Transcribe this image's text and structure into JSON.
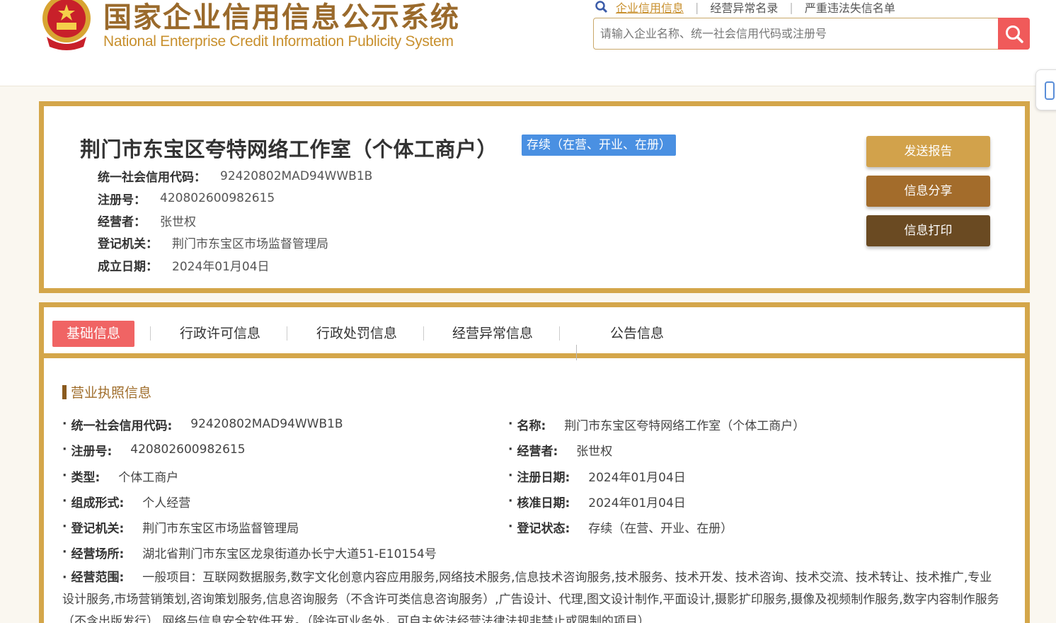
{
  "header": {
    "title": "国家企业信用信息公示系统",
    "subtitle": "National Enterprise Credit Information Publicity System",
    "links": [
      "企业信用信息",
      "经营异常名录",
      "严重违法失信名单"
    ],
    "search_placeholder": "请输入企业名称、统一社会信用代码或注册号"
  },
  "company": {
    "name": "荆门市东宝区夸特网络工作室（个体工商户）",
    "status": "存续（在营、开业、在册）",
    "rows": [
      {
        "label": "统一社会信用代码：",
        "value": "92420802MAD94WWB1B"
      },
      {
        "label": "注册号：",
        "value": "420802600982615"
      },
      {
        "label": "经营者：",
        "value": "张世权"
      },
      {
        "label": "登记机关：",
        "value": "荆门市东宝区市场监督管理局"
      },
      {
        "label": "成立日期：",
        "value": "2024年01月04日"
      }
    ],
    "buttons": {
      "report": "发送报告",
      "share": "信息分享",
      "print": "信息打印"
    }
  },
  "tabs": [
    "基础信息",
    "行政许可信息",
    "行政处罚信息",
    "经营异常信息",
    "公告信息"
  ],
  "section": {
    "title": "营业执照信息",
    "left": [
      {
        "label": "统一社会信用代码:",
        "value": "92420802MAD94WWB1B"
      },
      {
        "label": "注册号:",
        "value": "420802600982615"
      },
      {
        "label": "类型:",
        "value": "个体工商户"
      },
      {
        "label": "组成形式:",
        "value": "个人经营"
      },
      {
        "label": "登记机关:",
        "value": "荆门市东宝区市场监督管理局"
      },
      {
        "label": "经营场所:",
        "value": "湖北省荆门市东宝区龙泉街道办长宁大道51-E10154号"
      }
    ],
    "right": [
      {
        "label": "名称:",
        "value": "荆门市东宝区夸特网络工作室（个体工商户）"
      },
      {
        "label": "经营者:",
        "value": "张世权"
      },
      {
        "label": "注册日期:",
        "value": "2024年01月04日"
      },
      {
        "label": "核准日期:",
        "value": "2024年01月04日"
      },
      {
        "label": "登记状态:",
        "value": "存续（在营、开业、在册）"
      }
    ],
    "scope": {
      "label": "经营范围:",
      "value": "一般项目：互联网数据服务,数字文化创意内容应用服务,网络技术服务,信息技术咨询服务,技术服务、技术开发、技术咨询、技术交流、技术转让、技术推广,专业设计服务,市场营销策划,咨询策划服务,信息咨询服务（不含许可类信息咨询服务）,广告设计、代理,图文设计制作,平面设计,摄影扩印服务,摄像及视频制作服务,数字内容制作服务（不含出版发行）,网络与信息安全软件开发。（除许可业务外，可自主依法经营法律法规非禁止或限制的项目）"
    }
  },
  "colors": {
    "gold": "#d4a64a",
    "brown": "#a06e2c",
    "red": "#f06464",
    "blue": "#4a90e2"
  }
}
